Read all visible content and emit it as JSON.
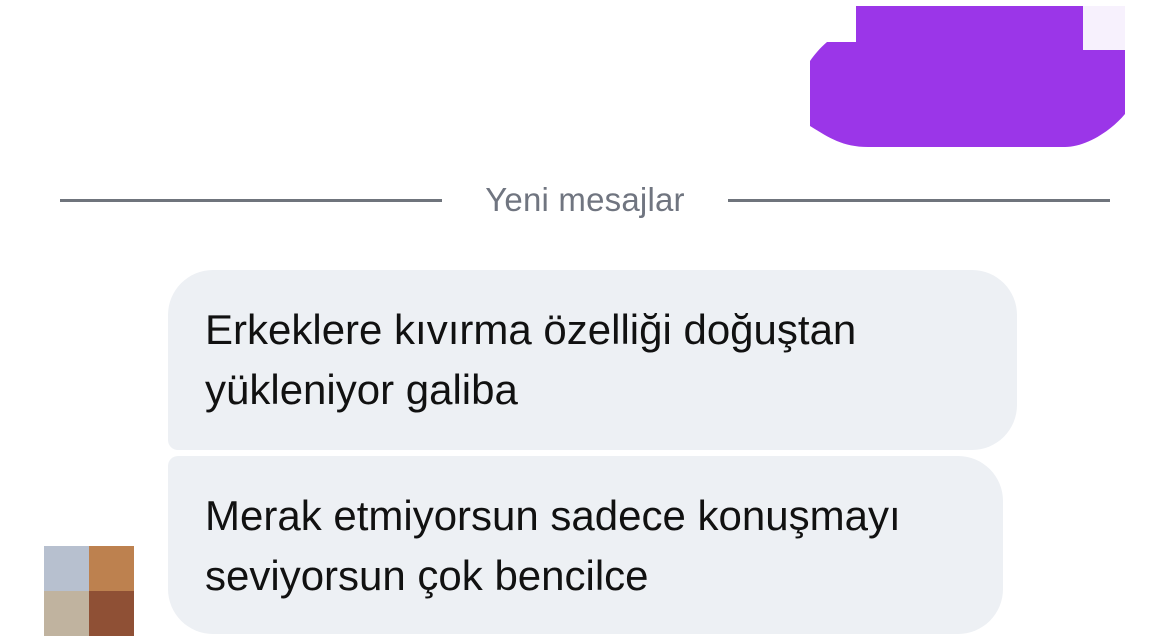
{
  "chat": {
    "divider_label": "Yeni mesajlar",
    "messages": [
      {
        "id": "incoming-1",
        "text": "Erkeklere kıvırma özelliği doğuştan yükleniyor galiba"
      },
      {
        "id": "incoming-2",
        "text": "Merak etmiyorsun sadece konuşmayı seviyorsun çok bencilce"
      }
    ],
    "sent_message_redacted": true
  },
  "colors": {
    "sent_bubble": "#9b36e8",
    "received_bubble": "#edf0f4",
    "divider_line": "#6f747c",
    "divider_text": "#707580",
    "message_text": "#111111"
  },
  "avatar_pixels": [
    "#b7c0cf",
    "#bd814f",
    "#c0b39f",
    "#8f5035"
  ]
}
